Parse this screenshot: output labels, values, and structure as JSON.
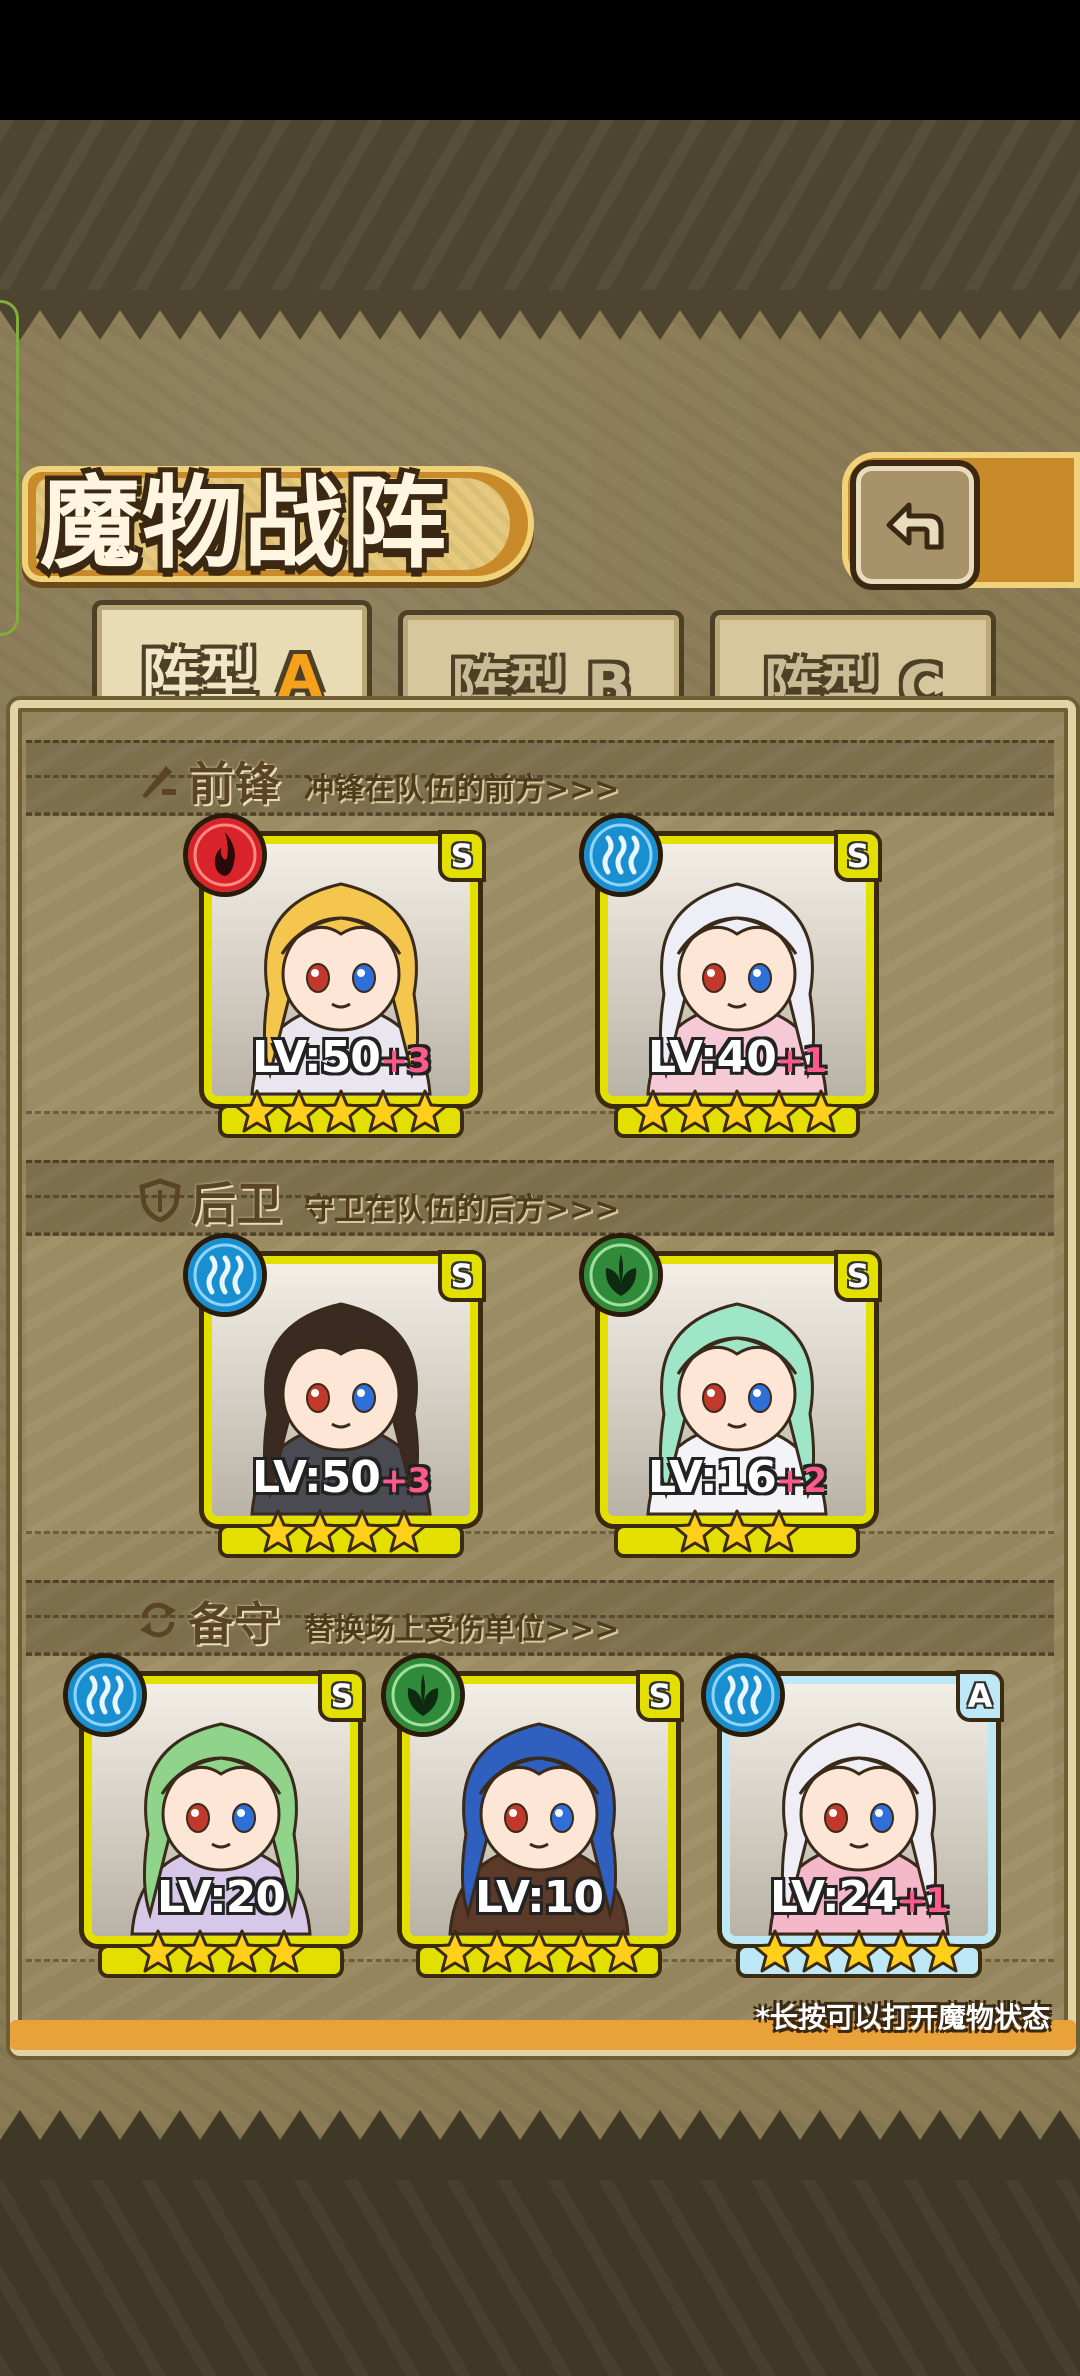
{
  "header": {
    "title": "魔物战阵",
    "back_icon": "back-arrow-icon"
  },
  "tabs": [
    {
      "label": "阵型",
      "letter": "A",
      "active": true
    },
    {
      "label": "阵型",
      "letter": "B",
      "active": false
    },
    {
      "label": "阵型",
      "letter": "C",
      "active": false
    }
  ],
  "sections": {
    "front": {
      "title": "前锋",
      "subtitle": "冲锋在队伍的前方>>>",
      "icon": "sword-icon"
    },
    "rear": {
      "title": "后卫",
      "subtitle": "守卫在队伍的后方>>>",
      "icon": "shield-icon"
    },
    "reserve": {
      "title": "备守",
      "subtitle": "替换场上受伤单位>>>",
      "icon": "swap-icon"
    }
  },
  "units": {
    "front": [
      {
        "level": "LV:50",
        "plus": "+3",
        "rank": "S",
        "element": "fire",
        "stars": 5,
        "hair": "#f4c64e",
        "outfit": "#e9e6f0"
      },
      {
        "level": "LV:40",
        "plus": "+1",
        "rank": "S",
        "element": "water",
        "stars": 5,
        "hair": "#eeeef6",
        "outfit": "#f5c9d6"
      }
    ],
    "rear": [
      {
        "level": "LV:50",
        "plus": "+3",
        "rank": "S",
        "element": "water",
        "stars": 4,
        "hair": "#3a2a22",
        "outfit": "#4a4a52"
      },
      {
        "level": "LV:16",
        "plus": "+2",
        "rank": "S",
        "element": "wood",
        "stars": 3,
        "hair": "#9fe6c8",
        "outfit": "#f3f3f8"
      }
    ],
    "reserve": [
      {
        "level": "LV:20",
        "plus": "",
        "rank": "S",
        "element": "water",
        "stars": 4,
        "hair": "#8fd48a",
        "outfit": "#d7c8ea"
      },
      {
        "level": "LV:10",
        "plus": "",
        "rank": "S",
        "element": "wood",
        "stars": 5,
        "hair": "#2f5fbf",
        "outfit": "#5b3a2a"
      },
      {
        "level": "LV:24",
        "plus": "+1",
        "rank": "A",
        "element": "water",
        "stars": 5,
        "hair": "#f0eef5",
        "outfit": "#f4b8c8"
      }
    ]
  },
  "hint": "*长按可以打开魔物状态",
  "colors": {
    "fire": "#d8232a",
    "water": "#1a8fd0",
    "wood": "#2f8a3a",
    "rank_s_frame": "#e3e000",
    "rank_a_frame": "#bfe8f7",
    "plus_text": "#ff5a8a",
    "tab_letter": "#f5a21a"
  }
}
